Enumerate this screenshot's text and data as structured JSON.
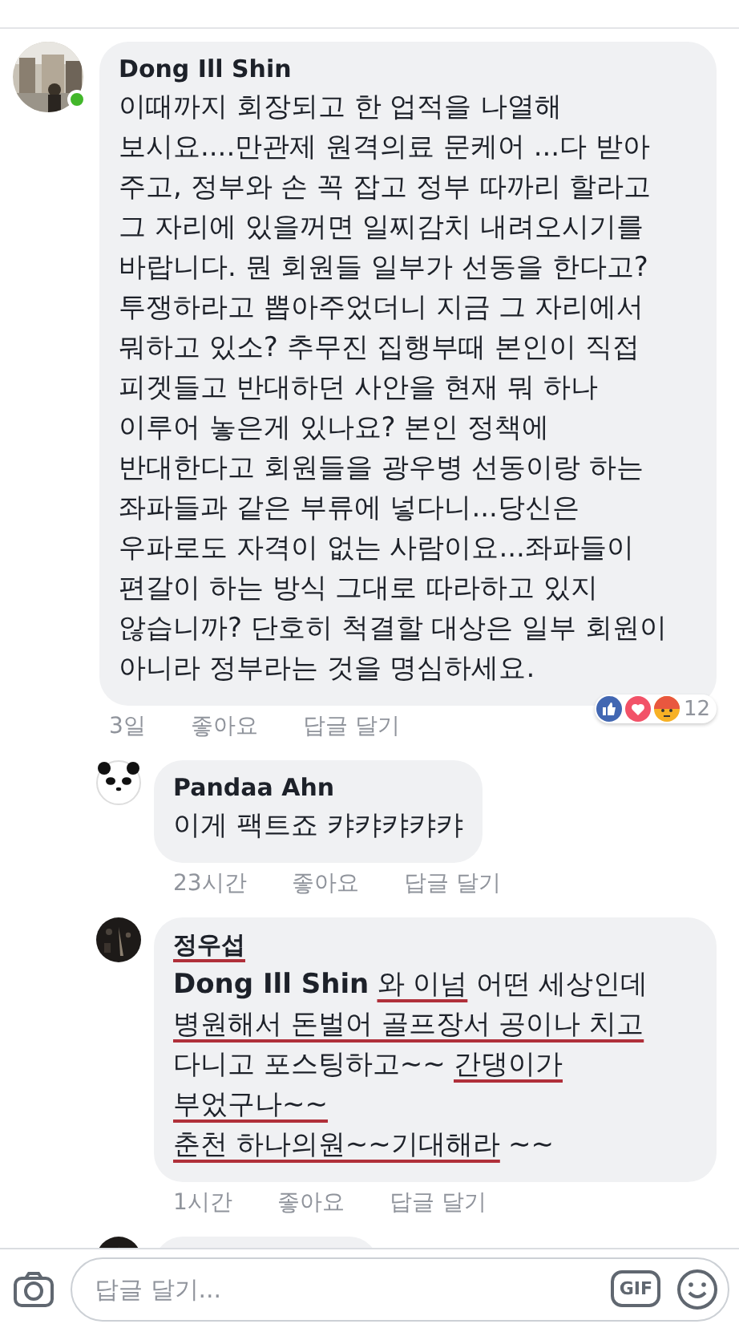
{
  "comments": [
    {
      "author": "Dong Ill Shin",
      "online": true,
      "indent": false,
      "name_underlined": false,
      "lines": [
        [
          {
            "text": "이때까지 회장되고 한 업적을 나열해"
          }
        ],
        [
          {
            "text": "보시요....만관제 원격의료 문케어 ...다 받아"
          }
        ],
        [
          {
            "text": "주고, 정부와 손 꼭 잡고 정부 따까리 할라고"
          }
        ],
        [
          {
            "text": "그 자리에 있을꺼면 일찌감치 내려오시기를"
          }
        ],
        [
          {
            "text": "바랍니다. 뭔 회원들 일부가 선동을 한다고?"
          }
        ],
        [
          {
            "text": "투쟁하라고 뽑아주었더니 지금 그 자리에서"
          }
        ],
        [
          {
            "text": "뭐하고 있소? 추무진 집행부때 본인이 직접"
          }
        ],
        [
          {
            "text": "피겟들고  반대하던 사안을 현재 뭐 하나"
          }
        ],
        [
          {
            "text": "이루어 놓은게 있나요? 본인 정책에"
          }
        ],
        [
          {
            "text": "반대한다고 회원들을 광우병 선동이랑 하는"
          }
        ],
        [
          {
            "text": "좌파들과 같은 부류에 넣다니...당신은"
          }
        ],
        [
          {
            "text": "우파로도 자격이 없는 사람이요...좌파들이"
          }
        ],
        [
          {
            "text": "편갈이 하는 방식 그대로 따라하고 있지"
          }
        ],
        [
          {
            "text": "않습니까? 단호히 척결할 대상은 일부 회원이"
          }
        ],
        [
          {
            "text": "아니라 정부라는 것을 명심하세요."
          }
        ]
      ],
      "time": "3일",
      "like": "좋아요",
      "reply": "답글 달기",
      "reactions": {
        "count": "12"
      }
    },
    {
      "author": "Pandaa Ahn",
      "online": false,
      "indent": true,
      "name_underlined": false,
      "lines": [
        [
          {
            "text": "이게 팩트죠 캬캬캬캬캬"
          }
        ]
      ],
      "time": "23시간",
      "like": "좋아요",
      "reply": "답글 달기"
    },
    {
      "author": "정우섭",
      "online": false,
      "indent": true,
      "name_underlined": true,
      "lines": [
        [
          {
            "text": "Dong Ill Shin",
            "bold": true
          },
          {
            "text": "와 이넘",
            "underlined": true
          },
          {
            "text": "어떤 세상인데"
          }
        ],
        [
          {
            "text": "병원해서 돈벌어 골프장서 공이나 치고",
            "underlined": true
          }
        ],
        [
          {
            "text": "다니고 포스팅하고~~"
          },
          {
            "text": "간댕이가",
            "underlined": true
          }
        ],
        [
          {
            "text": "부었구나~~",
            "underlined": true
          }
        ],
        [
          {
            "text": "춘천 하나의원~~기대해라",
            "underlined": true
          },
          {
            "text": "~~"
          }
        ]
      ],
      "time": "1시간",
      "like": "좋아요",
      "reply": "답글 달기"
    }
  ],
  "composer": {
    "placeholder": "답글 달기...",
    "gif": "GIF"
  }
}
